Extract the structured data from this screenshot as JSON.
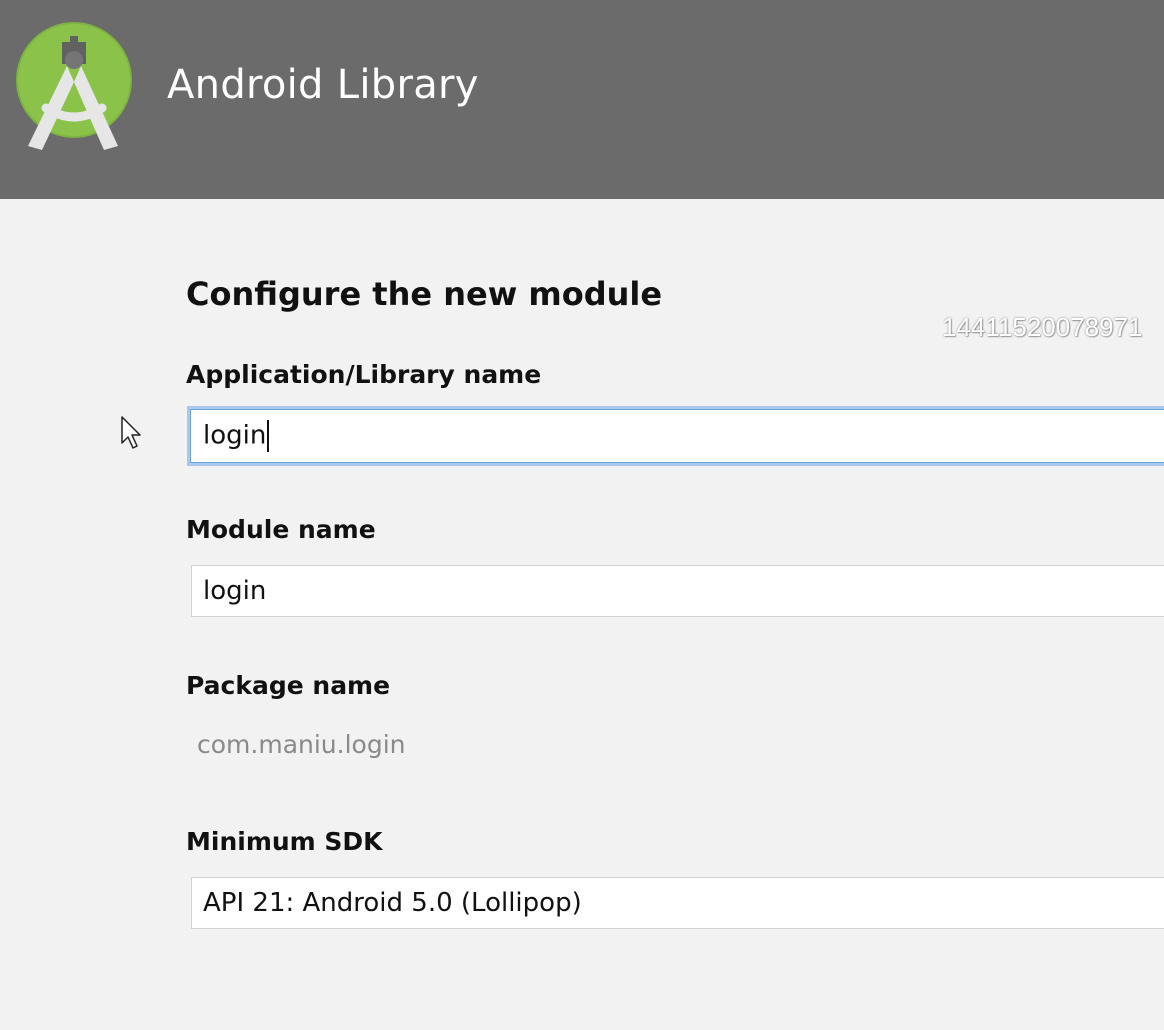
{
  "header": {
    "title": "Android Library",
    "background_color": "#6b6b6b",
    "logo_icon": "android-studio-logo-icon"
  },
  "main": {
    "page_title": "Configure the new module",
    "watermark": "14411520078971",
    "fields": {
      "app_library_name": {
        "label": "Application/Library name",
        "value": "login",
        "focused": true
      },
      "module_name": {
        "label": "Module name",
        "value": "login"
      },
      "package_name": {
        "label": "Package name",
        "value": "com.maniu.login"
      },
      "minimum_sdk": {
        "label": "Minimum SDK",
        "value": "API 21: Android 5.0 (Lollipop)"
      }
    }
  },
  "colors": {
    "page_background": "#f2f2f2",
    "focus_border": "#6fa1db",
    "muted_text": "#8a8a8a"
  }
}
